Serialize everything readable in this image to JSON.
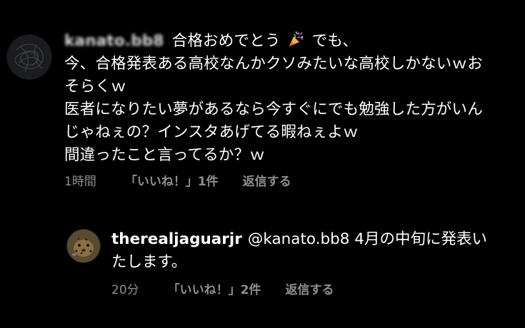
{
  "comment_1": {
    "username": "kanato.bb8",
    "first_line_text": "合格おめでとう",
    "first_line_after": "でも、",
    "lines": [
      "今、合格発表ある高校なんかクソみたいな高校しかないｗお",
      "そらくｗ",
      "医者になりたい夢があるなら今すぐにでも勉強した方がいん",
      "じゃねぇの？インスタあげてる暇ねぇよｗ",
      "間違ったこと言ってるか？ｗ"
    ],
    "time": "1時間",
    "likes": "「いいね！」1件",
    "reply": "返信する",
    "party_icon": "party-popper-icon"
  },
  "comment_2": {
    "username": "therealjaguarjr",
    "mention": "@kanato.bb8",
    "text_1": " 4月の中旬に発表い",
    "text_2": "たします。",
    "time": "20分",
    "likes": "「いいね！」2件",
    "reply": "返信する"
  },
  "colors": {
    "background": "#000000",
    "text": "#ffffff",
    "meta": "#8e8e8e"
  }
}
